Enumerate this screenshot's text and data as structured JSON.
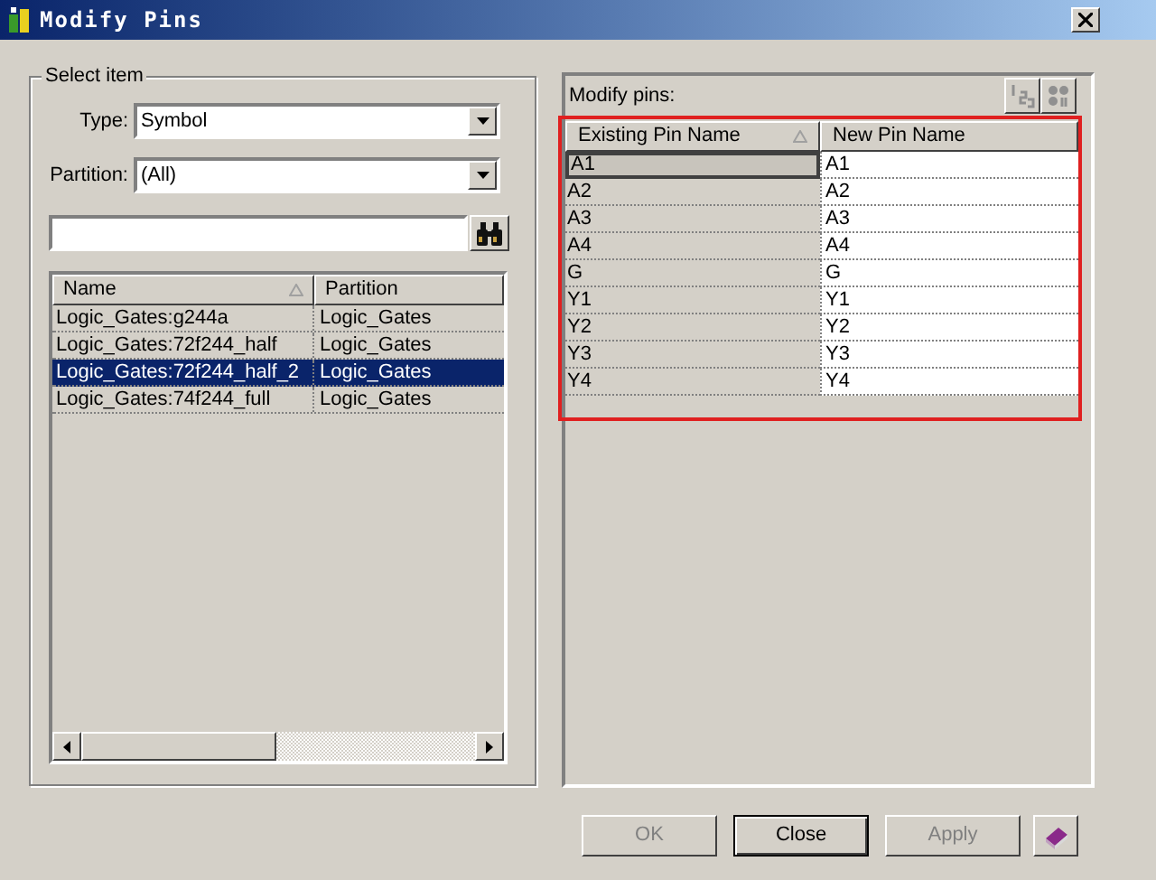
{
  "window": {
    "title": "Modify Pins"
  },
  "select_item": {
    "title": "Select item",
    "type": {
      "label": "Type:",
      "value": "Symbol"
    },
    "partition": {
      "label": "Partition:",
      "value": "(All)"
    },
    "columns": [
      "Name",
      "Partition"
    ],
    "rows": [
      {
        "name": "Logic_Gates:g244a",
        "partition": "Logic_Gates",
        "selected": false
      },
      {
        "name": "Logic_Gates:72f244_half",
        "partition": "Logic_Gates",
        "selected": false
      },
      {
        "name": "Logic_Gates:72f244_half_2",
        "partition": "Logic_Gates",
        "selected": true
      },
      {
        "name": "Logic_Gates:74f244_full",
        "partition": "Logic_Gates",
        "selected": false
      }
    ]
  },
  "modify_pins": {
    "label": "Modify pins:",
    "columns": [
      "Existing Pin Name",
      "New Pin Name"
    ],
    "rows": [
      {
        "existing": "A1",
        "new": "A1",
        "focused": true
      },
      {
        "existing": "A2",
        "new": "A2",
        "focused": false
      },
      {
        "existing": "A3",
        "new": "A3",
        "focused": false
      },
      {
        "existing": "A4",
        "new": "A4",
        "focused": false
      },
      {
        "existing": "G",
        "new": "G",
        "focused": false
      },
      {
        "existing": "Y1",
        "new": "Y1",
        "focused": false
      },
      {
        "existing": "Y2",
        "new": "Y2",
        "focused": false
      },
      {
        "existing": "Y3",
        "new": "Y3",
        "focused": false
      },
      {
        "existing": "Y4",
        "new": "Y4",
        "focused": false
      }
    ]
  },
  "buttons": [
    {
      "label": "OK",
      "disabled": true,
      "default": false
    },
    {
      "label": "Close",
      "disabled": false,
      "default": true
    },
    {
      "label": "Apply",
      "disabled": true,
      "default": false
    }
  ]
}
